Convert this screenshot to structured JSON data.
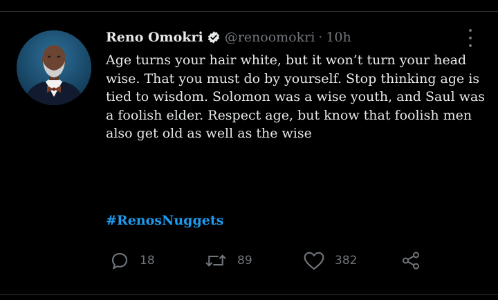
{
  "tweet": {
    "author_name": "Reno Omokri",
    "handle": "@renoomokri",
    "separator": "·",
    "time": "10h",
    "text": "Age turns your hair white, but it won’t turn your head wise. That you must do by yourself. Stop thinking age is tied to wisdom. Solomon was a wise youth, and Saul was a foolish elder. Respect age, but know that foolish men also get old as well as the wise",
    "hashtag": "#RenosNuggets"
  },
  "actions": {
    "reply_count": "18",
    "retweet_count": "89",
    "like_count": "382"
  },
  "icons": {
    "verified": "verified-badge-icon",
    "more": "more-icon",
    "reply": "reply-icon",
    "retweet": "retweet-icon",
    "like": "heart-icon",
    "share": "share-icon"
  },
  "colors": {
    "background": "#000000",
    "text": "#e7e9ea",
    "muted": "#71767b",
    "link": "#1d9bf0"
  }
}
